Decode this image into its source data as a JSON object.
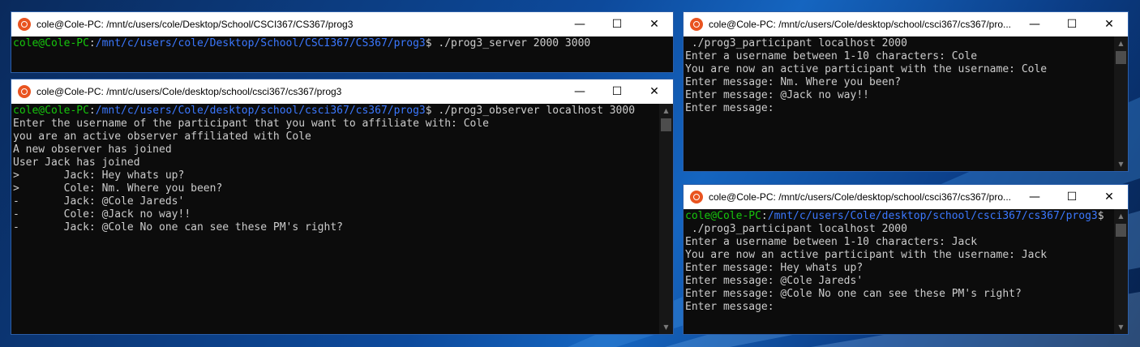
{
  "windows": {
    "server": {
      "title": "cole@Cole-PC: /mnt/c/users/cole/Desktop/School/CSCI367/CS367/prog3",
      "prompt_user": "cole@Cole-PC",
      "prompt_path": "/mnt/c/users/cole/Desktop/School/CSCI367/CS367/prog3",
      "command": "$ ./prog3_server 2000 3000"
    },
    "observer": {
      "title": "cole@Cole-PC: /mnt/c/users/Cole/desktop/school/csci367/cs367/prog3",
      "prompt_user": "cole@Cole-PC",
      "prompt_path": "/mnt/c/users/Cole/desktop/school/csci367/cs367/prog3",
      "command": "$ ./prog3_observer localhost 3000",
      "lines": [
        "Enter the username of the participant that you want to affiliate with: Cole",
        "you are an active observer affiliated with Cole",
        "A new observer has joined",
        "User Jack has joined",
        ">       Jack: Hey whats up?",
        ">       Cole: Nm. Where you been?",
        "-       Jack: @Cole Jareds'",
        "-       Cole: @Jack no way!!",
        "-       Jack: @Cole No one can see these PM's right?"
      ]
    },
    "participant_cole": {
      "title": "cole@Cole-PC: /mnt/c/users/Cole/desktop/school/csci367/cs367/pro...",
      "lines": [
        " ./prog3_participant localhost 2000",
        "Enter a username between 1-10 characters: Cole",
        "You are now an active participant with the username: Cole",
        "Enter message: Nm. Where you been?",
        "Enter message: @Jack no way!!",
        "Enter message:"
      ]
    },
    "participant_jack": {
      "title": "cole@Cole-PC: /mnt/c/users/Cole/desktop/school/csci367/cs367/pro...",
      "prompt_user": "cole@Cole-PC",
      "prompt_path": "/mnt/c/users/Cole/desktop/school/csci367/cs367/prog3",
      "prompt_dollar": "$",
      "lines": [
        " ./prog3_participant localhost 2000",
        "Enter a username between 1-10 characters: Jack",
        "You are now an active participant with the username: Jack",
        "Enter message: Hey whats up?",
        "Enter message: @Cole Jareds'",
        "Enter message: @Cole No one can see these PM's right?",
        "Enter message:"
      ]
    }
  },
  "controls": {
    "minimize": "—",
    "maximize": "☐",
    "close": "✕"
  },
  "icons": {
    "app": "ubuntu-icon"
  },
  "colors": {
    "prompt_user": "#16c60c",
    "prompt_path": "#3b78ff",
    "terminal_bg": "#0c0c0c"
  }
}
